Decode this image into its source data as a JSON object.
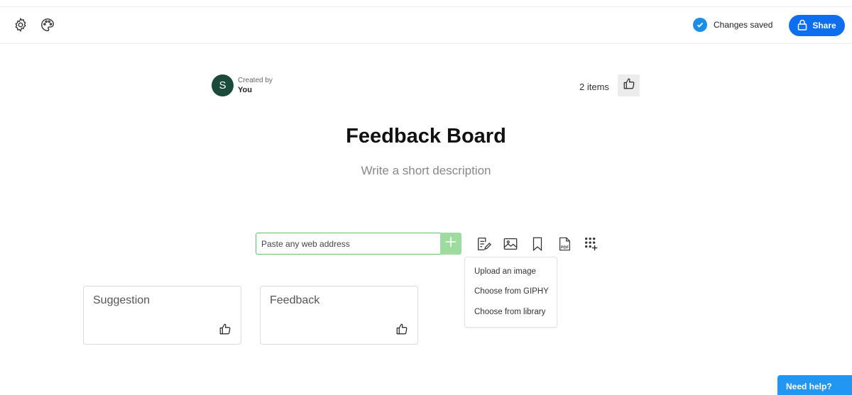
{
  "header": {
    "status_text": "Changes saved",
    "share_label": "Share",
    "icons": [
      "gear-icon",
      "palette-icon",
      "check-circle-icon",
      "lock-icon"
    ]
  },
  "board": {
    "avatar_letter": "S",
    "created_by_label": "Created by",
    "creator": "You",
    "items_count": "2 items",
    "title": "Feedback Board",
    "description_placeholder": "Write a short description"
  },
  "add_bar": {
    "url_placeholder": "Paste any web address",
    "tools": [
      "note-icon",
      "image-icon",
      "bookmark-icon",
      "pdf-icon",
      "apps-add-icon"
    ]
  },
  "image_menu": {
    "items": [
      "Upload an image",
      "Choose from GIPHY",
      "Choose from library"
    ]
  },
  "cards": [
    {
      "title": "Suggestion"
    },
    {
      "title": "Feedback"
    }
  ],
  "help": {
    "label": "Need help?"
  },
  "colors": {
    "accent": "#0d6ef0",
    "saved_check": "#1a8fe8",
    "add_button": "#9edb9e",
    "input_border": "#5ec45e",
    "avatar": "#1c4a3b",
    "help": "#2196f3"
  }
}
